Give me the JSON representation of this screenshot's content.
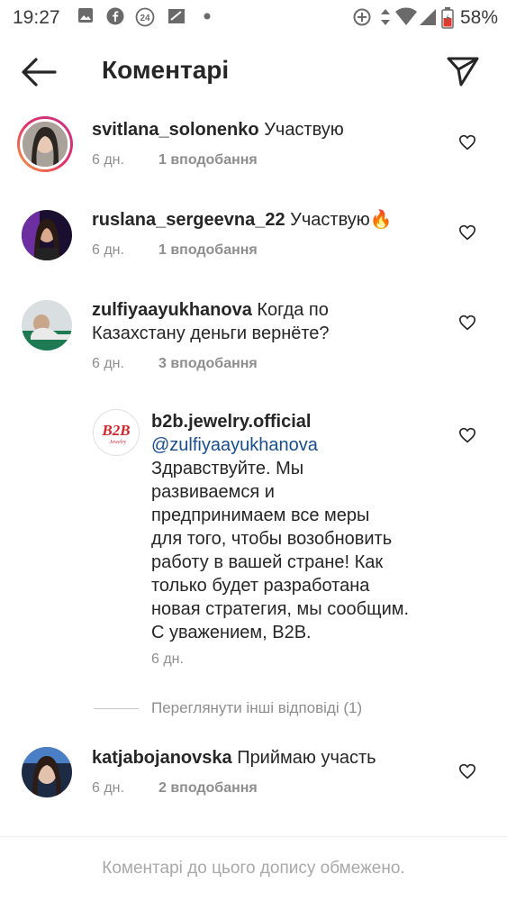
{
  "status_bar": {
    "time": "19:27",
    "battery": "58%",
    "icons": [
      "image-icon",
      "facebook-icon",
      "badge-24-icon",
      "signal-box-icon",
      "dot-icon",
      "data-saver-icon",
      "data-arrows-icon",
      "wifi-icon",
      "cell-signal-icon",
      "battery-icon"
    ]
  },
  "header": {
    "title": "Коментарі",
    "back_icon": "arrow-left-icon",
    "share_icon": "send-icon"
  },
  "comments": [
    {
      "user": "svitlana_solonenko",
      "text": "Участвую",
      "time": "6 дн.",
      "likes": "1 вподобання"
    },
    {
      "user": "ruslana_sergeevna_22",
      "text": "Участвую🔥",
      "time": "6 дн.",
      "likes": "1 вподобання"
    },
    {
      "user": "zulfiyaayukhanova",
      "text": "Когда по",
      "text2": "Казахстану деньги вернёте?",
      "time": "6 дн.",
      "likes": "3 вподобання"
    },
    {
      "user": "katjabojanovska",
      "text": "Приймаю участь",
      "time": "6 дн.",
      "likes": "2 вподобання"
    }
  ],
  "reply": {
    "user": "b2b.jewelry.official",
    "avatar_text": "B2B",
    "avatar_sub": "Jewelry",
    "mention": "@zulfiyaayukhanova",
    "lines": [
      "Здравствуйте. Мы",
      "развиваемся и",
      "предпринимаем все меры",
      "для того, чтобы возобновить",
      "работу в вашей стране! Как",
      "только будет разработана",
      "новая стратегия, мы сообщим.",
      "С уважением, B2B."
    ],
    "time": "6 дн."
  },
  "view_replies": "Переглянути інші відповіді (1)",
  "footer": {
    "message": "Коментарі до цього допису обмежено."
  },
  "colors": {
    "mention": "#1b4d8c",
    "meta": "#8e8e8e",
    "ring_start": "#f9a13a",
    "ring_end": "#c13584"
  }
}
